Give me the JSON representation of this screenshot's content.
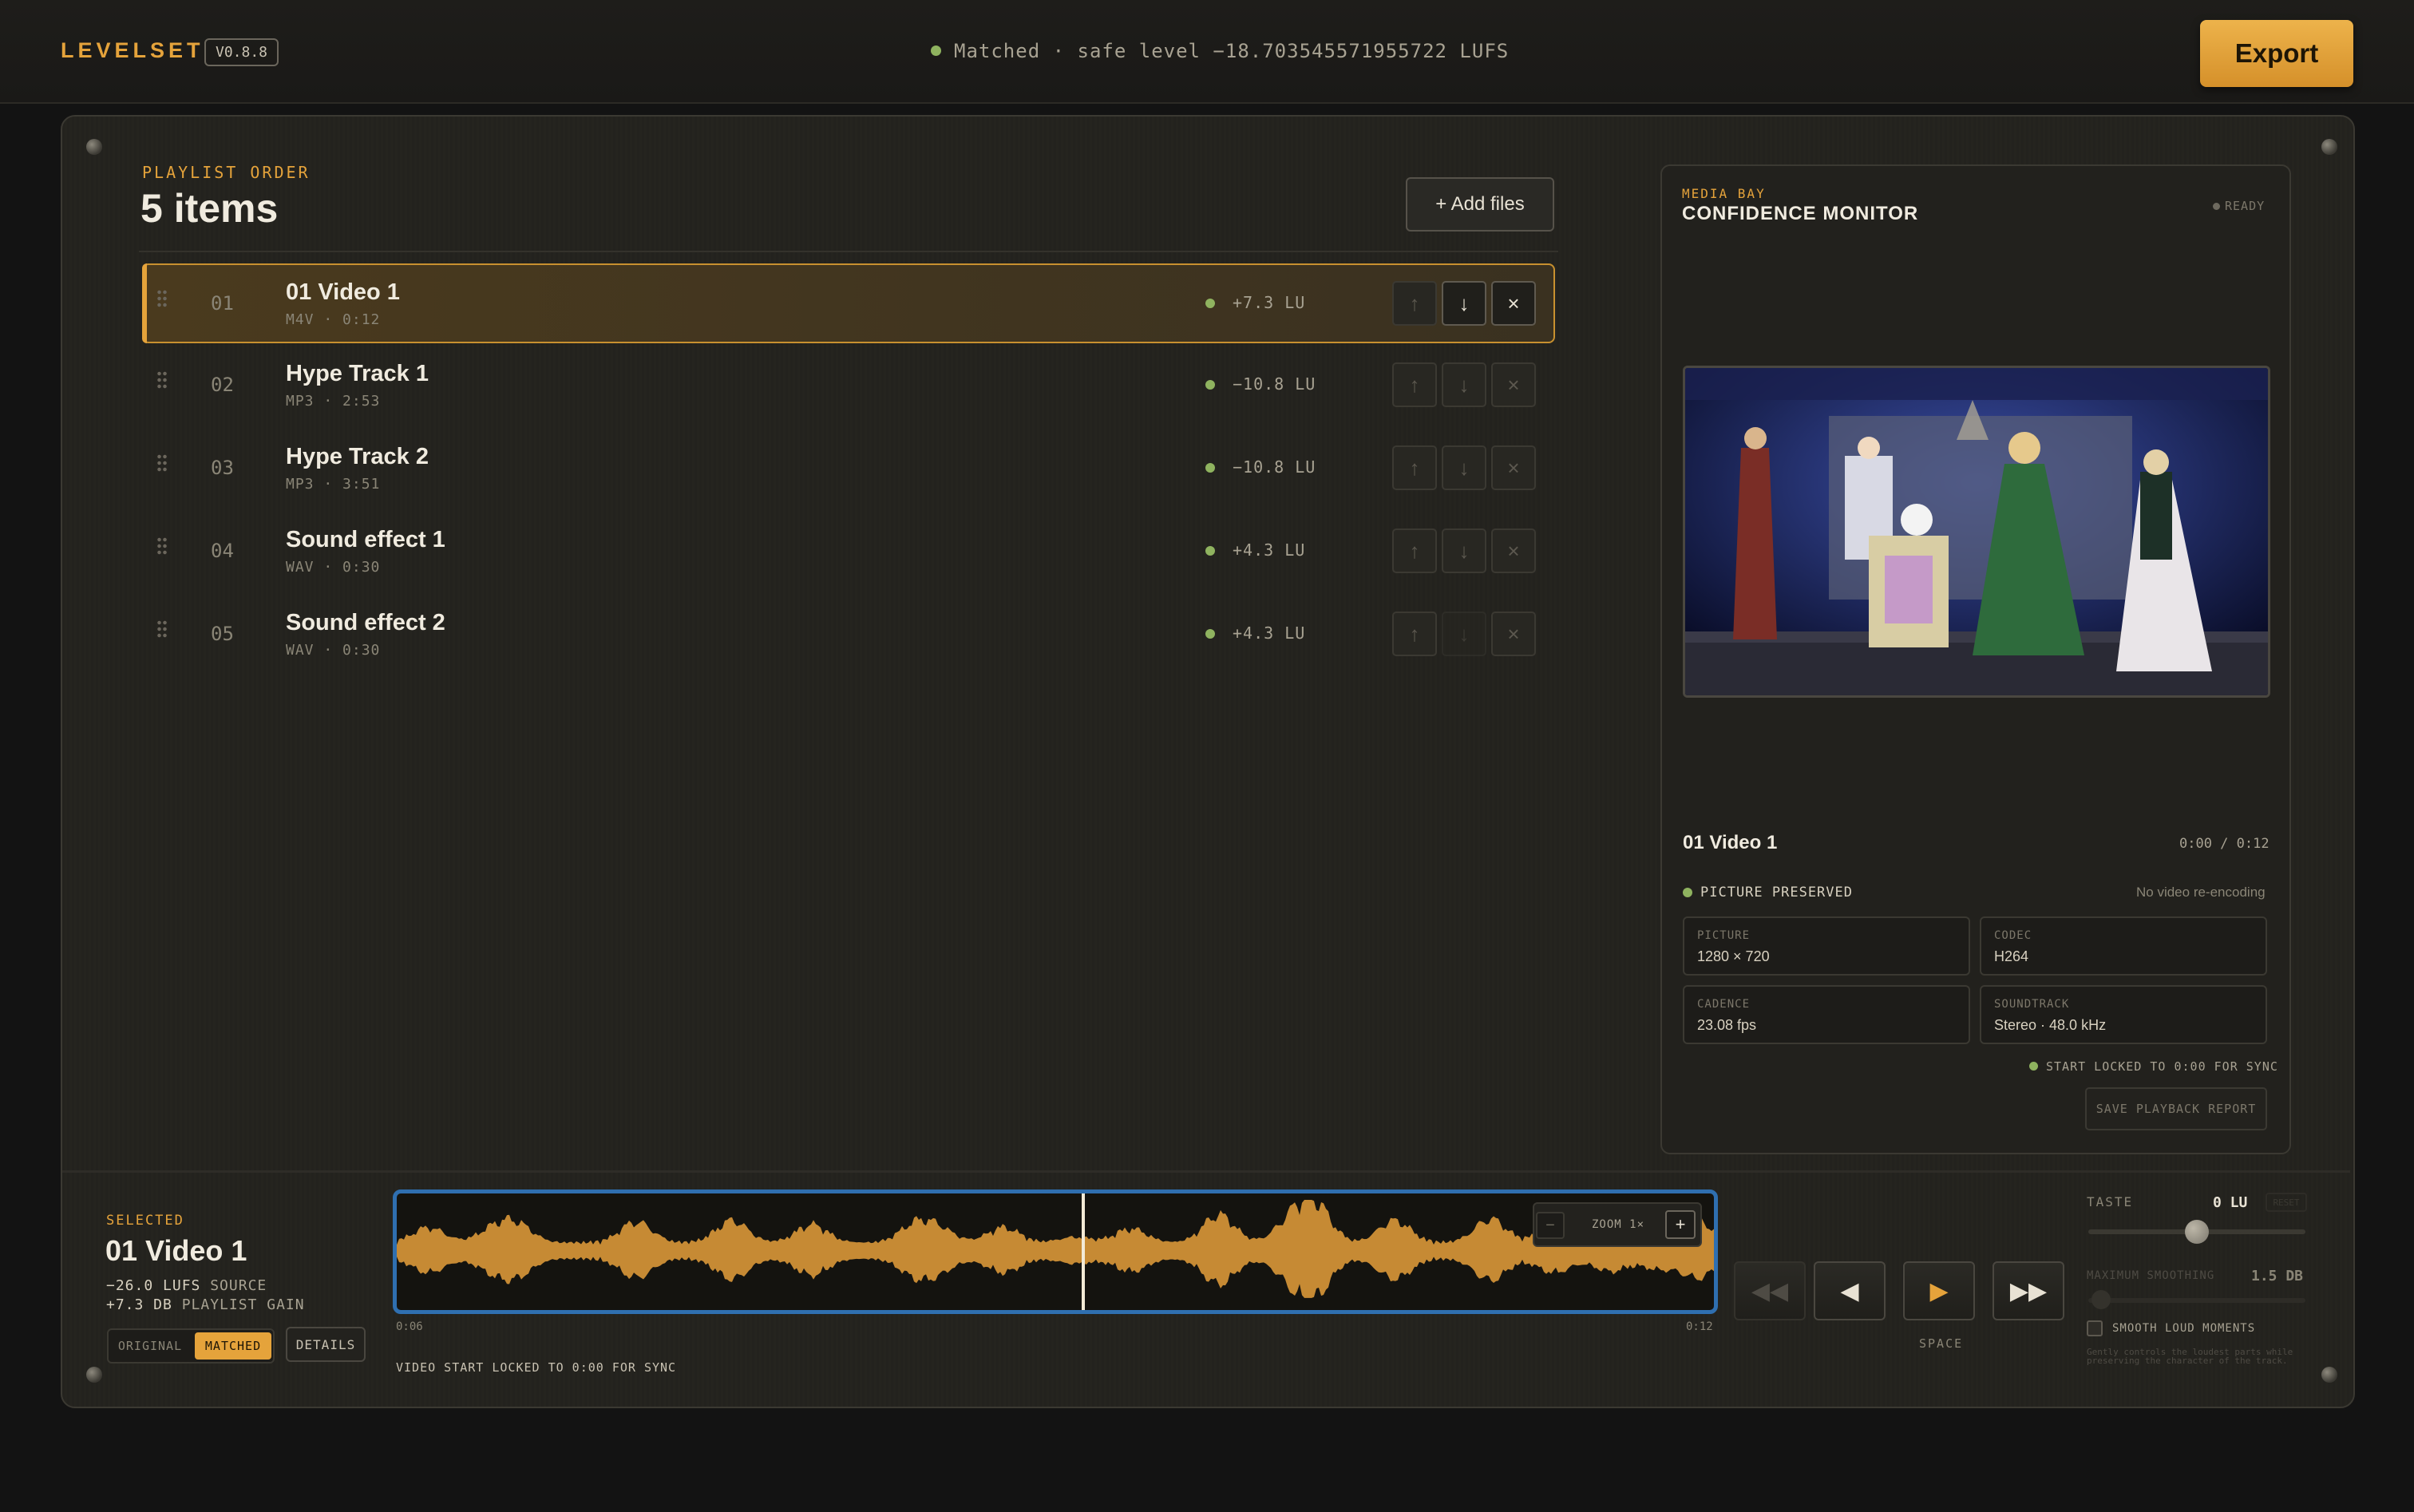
{
  "app": {
    "name": "LEVELSET",
    "version": "V0.8.8",
    "status": "Matched · safe level −18.703545571955722 LUFS",
    "export_label": "Export"
  },
  "playlist": {
    "kicker": "PLAYLIST ORDER",
    "count": "5 items",
    "add_label": "+ Add files",
    "selected_index": 0,
    "items": [
      {
        "num": "01",
        "title": "01 Video 1",
        "meta": "M4V · 0:12",
        "gain": "+7.3 LU"
      },
      {
        "num": "02",
        "title": "Hype Track 1",
        "meta": "MP3 · 2:53",
        "gain": "−10.8 LU"
      },
      {
        "num": "03",
        "title": "Hype Track 2",
        "meta": "MP3 · 3:51",
        "gain": "−10.8 LU"
      },
      {
        "num": "04",
        "title": "Sound effect 1",
        "meta": "WAV · 0:30",
        "gain": "+4.3 LU"
      },
      {
        "num": "05",
        "title": "Sound effect 2",
        "meta": "WAV · 0:30",
        "gain": "+4.3 LU"
      }
    ]
  },
  "icons": {
    "drag": "drag-handle-icon",
    "up": "arrow-up-icon",
    "down": "arrow-down-icon",
    "remove": "close-icon"
  },
  "monitor": {
    "kicker": "MEDIA BAY",
    "title": "CONFIDENCE MONITOR",
    "ready": "READY",
    "clip_name": "01 Video 1",
    "time": "0:00 / 0:12",
    "preserved": "PICTURE PRESERVED",
    "no_reencode": "No video re-encoding",
    "specs": [
      {
        "k": "PICTURE",
        "v": "1280 × 720"
      },
      {
        "k": "CODEC",
        "v": "H264"
      },
      {
        "k": "CADENCE",
        "v": "23.08 fps"
      },
      {
        "k": "SOUNDTRACK",
        "v": "Stereo · 48.0 kHz"
      }
    ],
    "lock_note": "START LOCKED TO 0:00 FOR SYNC",
    "save_report": "SAVE PLAYBACK REPORT"
  },
  "selected": {
    "kicker": "SELECTED",
    "title": "01 Video 1",
    "lufs_value": "−26.0 LUFS",
    "lufs_label": "SOURCE",
    "gain_value": "+7.3 DB",
    "gain_label": "PLAYLIST GAIN",
    "mode_original": "ORIGINAL",
    "mode_matched": "MATCHED",
    "details": "DETAILS"
  },
  "waveform": {
    "zoom_label": "ZOOM 1×",
    "zoom_minus": "−",
    "zoom_plus": "+",
    "start": "0:06",
    "end": "0:12",
    "playhead_fraction": 0.52,
    "note": "VIDEO START LOCKED TO 0:00 FOR SYNC",
    "color": "#c68a34"
  },
  "transport": {
    "rewind": "◀◀",
    "prev": "◀",
    "play": "▶",
    "forward": "▶▶",
    "hint": "SPACE"
  },
  "taste": {
    "label": "TASTE",
    "value": "0 LU",
    "reset": "RESET",
    "knob_fraction": 0.5,
    "smoothing_label": "MAXIMUM SMOOTHING",
    "smoothing_value": "1.5 DB",
    "smooth_checkbox": "SMOOTH LOUD MOMENTS",
    "smooth_checked": false,
    "smooth_desc": "Gently controls the loudest parts while preserving the character of the track."
  },
  "colors": {
    "accent": "#e5a33b",
    "ok": "#8fb35f",
    "wave_frame": "#2f6fb0"
  }
}
